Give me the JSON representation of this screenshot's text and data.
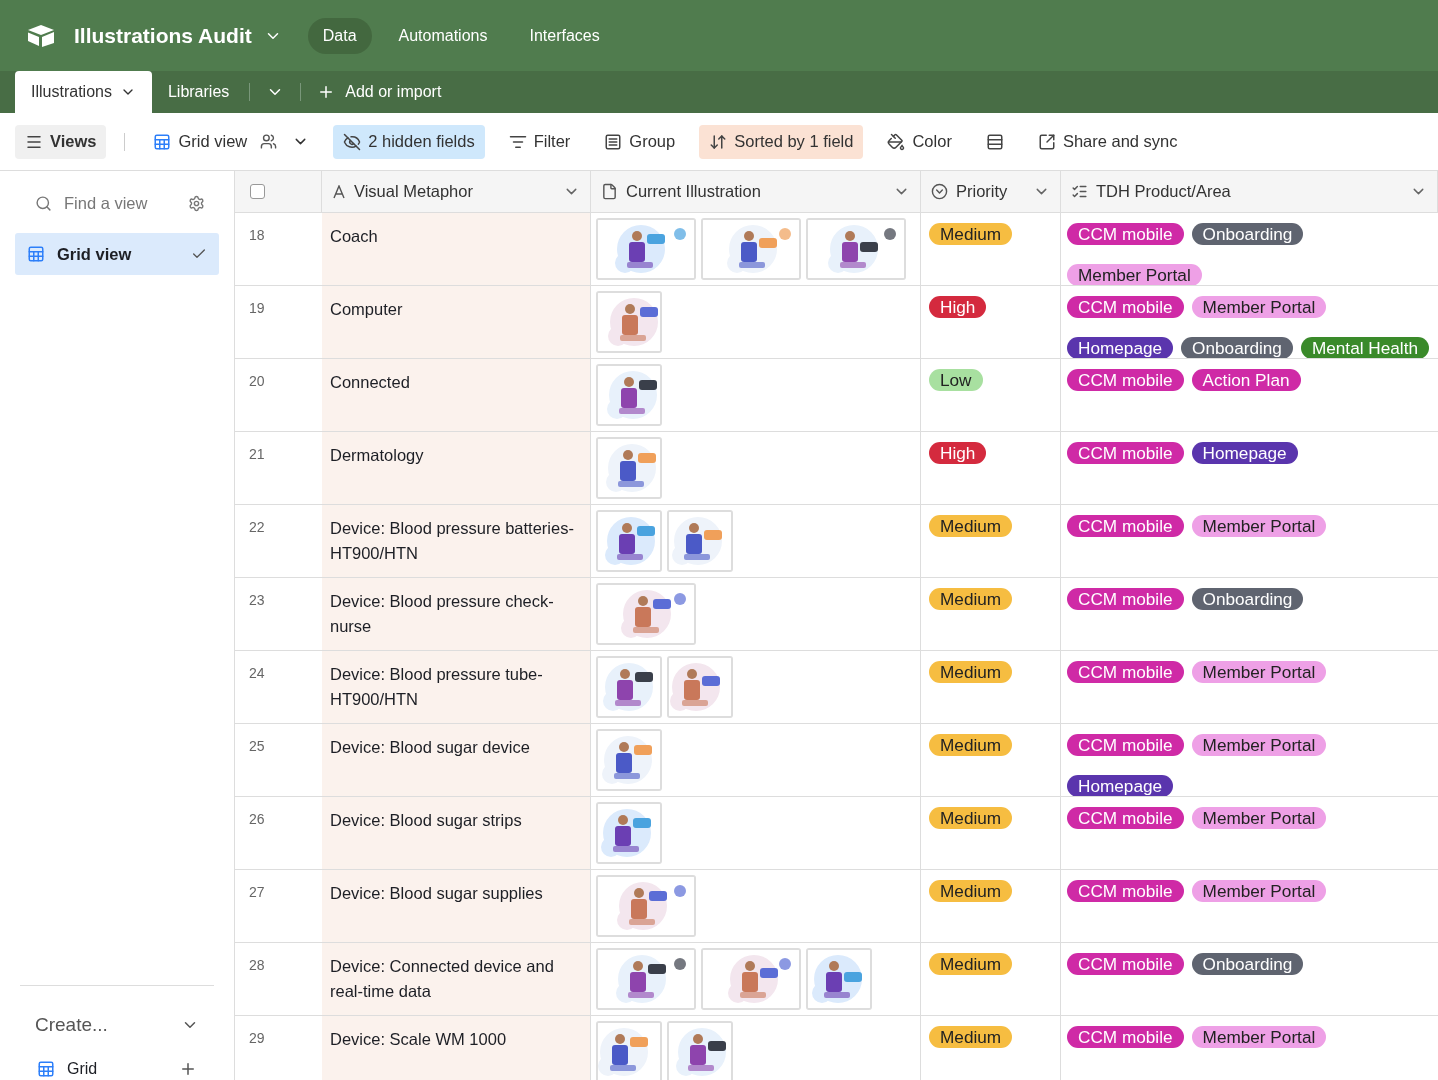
{
  "app": {
    "title": "Illustrations Audit",
    "nav": [
      {
        "label": "Data",
        "selected": true
      },
      {
        "label": "Automations",
        "selected": false
      },
      {
        "label": "Interfaces",
        "selected": false
      }
    ]
  },
  "tables": [
    {
      "label": "Illustrations",
      "selected": true
    },
    {
      "label": "Libraries",
      "selected": false
    }
  ],
  "add_table": {
    "label": "Add or import"
  },
  "toolbar": [
    {
      "kind": "views",
      "label": "Views"
    },
    {
      "kind": "view",
      "label": "Grid view"
    },
    {
      "kind": "hidden",
      "label": "2 hidden fields"
    },
    {
      "kind": "filter",
      "label": "Filter"
    },
    {
      "kind": "group",
      "label": "Group"
    },
    {
      "kind": "sort",
      "label": "Sorted by 1 field"
    },
    {
      "kind": "color",
      "label": "Color"
    },
    {
      "kind": "row_height"
    },
    {
      "kind": "share",
      "label": "Share and sync"
    }
  ],
  "sidebar": {
    "search": {
      "placeholder": "Find a view"
    },
    "items": [
      {
        "label": "Grid view",
        "selected": true
      }
    ],
    "create": {
      "label": "Create..."
    },
    "create_items": [
      {
        "label": "Grid"
      }
    ]
  },
  "table": {
    "select_all": {
      "checked": false
    },
    "columns": [
      {
        "kind": "text",
        "label": "Visual Metaphor"
      },
      {
        "kind": "attachment",
        "label": "Current Illustration"
      },
      {
        "kind": "select",
        "label": "Priority"
      },
      {
        "kind": "multiselect",
        "label": "TDH Product/Area"
      }
    ],
    "rows": [
      {
        "number": "18",
        "name": "Coach",
        "pictures": [
          {
            "kind": "picture",
            "wide": true
          },
          {
            "kind": "picture",
            "wide": true
          },
          {
            "kind": "picture",
            "wide": true
          }
        ],
        "priority": {
          "label": "Medium",
          "color": "#f6bd41"
        },
        "tags": [
          {
            "label": "CCM mobile",
            "color": "#cf2aa6"
          },
          {
            "label": "Onboarding",
            "color": "#5f6470"
          },
          {
            "label": "Member Portal",
            "color": "#eea0e6"
          }
        ]
      },
      {
        "number": "19",
        "name": "Computer",
        "pictures": [
          {
            "kind": "picture",
            "wide": false
          }
        ],
        "priority": {
          "label": "High",
          "color": "#d42a3e"
        },
        "tags": [
          {
            "label": "CCM mobile",
            "color": "#cf2aa6"
          },
          {
            "label": "Member Portal",
            "color": "#eea0e6"
          },
          {
            "label": "Homepage",
            "color": "#5a35ad"
          },
          {
            "label": "Onboarding",
            "color": "#5f6470"
          },
          {
            "label": "Mental Health",
            "color": "#3a8a2a"
          }
        ]
      },
      {
        "number": "20",
        "name": "Connected",
        "pictures": [
          {
            "kind": "picture",
            "wide": false
          }
        ],
        "priority": {
          "label": "Low",
          "color": "#a8e0a0"
        },
        "tags": [
          {
            "label": "CCM mobile",
            "color": "#cf2aa6"
          },
          {
            "label": "Action Plan",
            "color": "#cf2aa6"
          }
        ]
      },
      {
        "number": "21",
        "name": "Dermatology",
        "pictures": [
          {
            "kind": "picture",
            "wide": false
          }
        ],
        "priority": {
          "label": "High",
          "color": "#d42a3e"
        },
        "tags": [
          {
            "label": "CCM mobile",
            "color": "#cf2aa6"
          },
          {
            "label": "Homepage",
            "color": "#5a35ad"
          }
        ]
      },
      {
        "number": "22",
        "name": "Device: Blood pressure batteries-HT900/HTN",
        "pictures": [
          {
            "kind": "picture",
            "wide": false
          },
          {
            "kind": "picture",
            "wide": false
          }
        ],
        "priority": {
          "label": "Medium",
          "color": "#f6bd41"
        },
        "tags": [
          {
            "label": "CCM mobile",
            "color": "#cf2aa6"
          },
          {
            "label": "Member Portal",
            "color": "#eea0e6"
          }
        ]
      },
      {
        "number": "23",
        "name": "Device: Blood pressure check-nurse",
        "pictures": [
          {
            "kind": "picture",
            "wide": true
          }
        ],
        "priority": {
          "label": "Medium",
          "color": "#f6bd41"
        },
        "tags": [
          {
            "label": "CCM mobile",
            "color": "#cf2aa6"
          },
          {
            "label": "Onboarding",
            "color": "#5f6470"
          }
        ]
      },
      {
        "number": "24",
        "name": "Device: Blood pressure tube-HT900/HTN",
        "pictures": [
          {
            "kind": "picture",
            "wide": false
          },
          {
            "kind": "picture",
            "wide": false
          }
        ],
        "priority": {
          "label": "Medium",
          "color": "#f6bd41"
        },
        "tags": [
          {
            "label": "CCM mobile",
            "color": "#cf2aa6"
          },
          {
            "label": "Member Portal",
            "color": "#eea0e6"
          }
        ]
      },
      {
        "number": "25",
        "name": "Device: Blood sugar device",
        "pictures": [
          {
            "kind": "picture",
            "wide": false
          }
        ],
        "priority": {
          "label": "Medium",
          "color": "#f6bd41"
        },
        "tags": [
          {
            "label": "CCM mobile",
            "color": "#cf2aa6"
          },
          {
            "label": "Member Portal",
            "color": "#eea0e6"
          },
          {
            "label": "Homepage",
            "color": "#5a35ad"
          }
        ]
      },
      {
        "number": "26",
        "name": "Device: Blood sugar strips",
        "pictures": [
          {
            "kind": "picture",
            "wide": false
          }
        ],
        "priority": {
          "label": "Medium",
          "color": "#f6bd41"
        },
        "tags": [
          {
            "label": "CCM mobile",
            "color": "#cf2aa6"
          },
          {
            "label": "Member Portal",
            "color": "#eea0e6"
          }
        ]
      },
      {
        "number": "27",
        "name": "Device: Blood sugar supplies",
        "pictures": [
          {
            "kind": "picture",
            "wide": true
          }
        ],
        "priority": {
          "label": "Medium",
          "color": "#f6bd41"
        },
        "tags": [
          {
            "label": "CCM mobile",
            "color": "#cf2aa6"
          },
          {
            "label": "Member Portal",
            "color": "#eea0e6"
          }
        ]
      },
      {
        "number": "28",
        "name": "Device: Connected device and real-time data",
        "pictures": [
          {
            "kind": "picture",
            "wide": true
          },
          {
            "kind": "picture",
            "wide": true
          },
          {
            "kind": "picture",
            "wide": false
          }
        ],
        "priority": {
          "label": "Medium",
          "color": "#f6bd41"
        },
        "tags": [
          {
            "label": "CCM mobile",
            "color": "#cf2aa6"
          },
          {
            "label": "Onboarding",
            "color": "#5f6470"
          }
        ]
      },
      {
        "number": "29",
        "name": "Device: Scale WM 1000",
        "pictures": [
          {
            "kind": "picture",
            "wide": false
          },
          {
            "kind": "picture",
            "wide": false
          }
        ],
        "priority": {
          "label": "Medium",
          "color": "#f6bd41"
        },
        "tags": [
          {
            "label": "CCM mobile",
            "color": "#cf2aa6"
          },
          {
            "label": "Member Portal",
            "color": "#eea0e6"
          }
        ]
      }
    ]
  }
}
